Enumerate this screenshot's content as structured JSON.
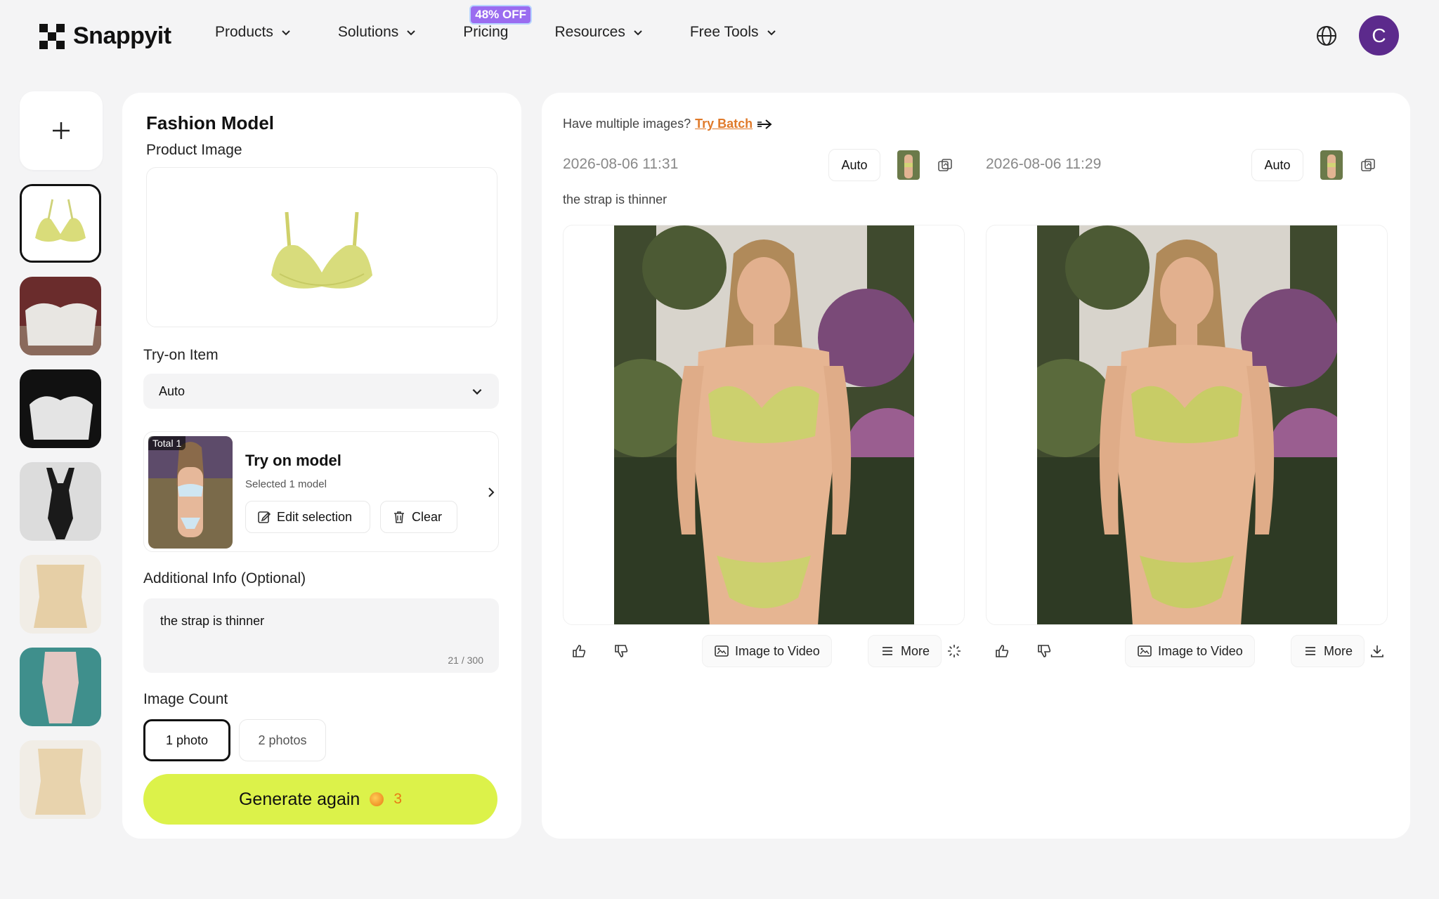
{
  "brand": {
    "name": "Snappyit"
  },
  "nav": {
    "items": [
      {
        "label": "Products",
        "dropdown": true
      },
      {
        "label": "Solutions",
        "dropdown": true
      },
      {
        "label": "Pricing",
        "dropdown": false,
        "badge": "48% OFF"
      },
      {
        "label": "Resources",
        "dropdown": true
      },
      {
        "label": "Free Tools",
        "dropdown": true
      }
    ],
    "globe_icon": "globe-icon",
    "avatar_letter": "C"
  },
  "sidebar": {
    "add_icon": "plus-icon"
  },
  "form": {
    "title": "Fashion Model",
    "product_image_label": "Product Image",
    "tryon_label": "Try-on Item",
    "tryon_value": "Auto",
    "model_card": {
      "badge": "Total 1",
      "title": "Try on model",
      "subtitle": "Selected 1 model",
      "edit_label": "Edit selection",
      "clear_label": "Clear"
    },
    "additional_label": "Additional Info (Optional)",
    "additional_value": "the strap is thinner",
    "additional_count": "21 / 300",
    "image_count_label": "Image Count",
    "count_options": [
      "1 photo",
      "2 photos"
    ],
    "count_selected": "1 photo",
    "generate_label": "Generate again",
    "generate_cost": "3"
  },
  "results": {
    "multi_text": "Have multiple images?",
    "try_batch": "Try Batch",
    "caption": "the strap is thinner",
    "columns": [
      {
        "timestamp": "2026-08-06 11:31",
        "mode": "Auto",
        "image_to_video": "Image to Video",
        "more": "More",
        "extra_icon": "loading-spinner-icon"
      },
      {
        "timestamp": "2026-08-06 11:29",
        "mode": "Auto",
        "image_to_video": "Image to Video",
        "more": "More",
        "extra_icon": "download-icon"
      }
    ]
  },
  "colors": {
    "accent_lime": "#dcf24a",
    "avatar": "#5c2a8c",
    "badge": "#9a6cf0",
    "link": "#e07a2a"
  }
}
